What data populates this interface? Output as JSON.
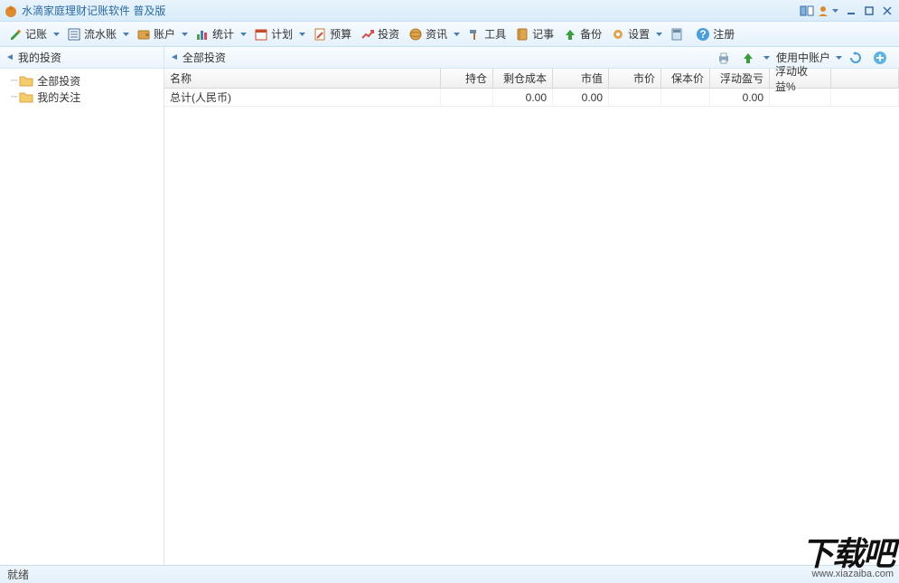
{
  "title": "水滴家庭理财记账软件 普及版",
  "toolbar": [
    {
      "label": "记账",
      "dd": true,
      "color": "#3a9d3a"
    },
    {
      "label": "流水账",
      "dd": true,
      "color": "#3a6aa6"
    },
    {
      "label": "账户",
      "dd": true,
      "color": "#c97a28"
    },
    {
      "label": "统计",
      "dd": true,
      "color": "#4a7db3"
    },
    {
      "label": "计划",
      "dd": true,
      "color": "#c94a28"
    },
    {
      "label": "预算",
      "dd": false,
      "color": "#c97a28"
    },
    {
      "label": "投资",
      "dd": false,
      "color": "#c94a28"
    },
    {
      "label": "资讯",
      "dd": true,
      "color": "#c97a28"
    },
    {
      "label": "工具",
      "dd": false,
      "color": "#6a8aa6"
    },
    {
      "label": "记事",
      "dd": false,
      "color": "#c97a28"
    },
    {
      "label": "备份",
      "dd": false,
      "color": "#3a9d3a"
    },
    {
      "label": "设置",
      "dd": true,
      "color": "#c97a28"
    },
    {
      "label": "注册",
      "dd": false,
      "color": "#3a7db3"
    }
  ],
  "sidebar": {
    "header": "我的投资",
    "items": [
      {
        "label": "全部投资"
      },
      {
        "label": "我的关注"
      }
    ]
  },
  "content": {
    "header": "全部投资",
    "account_label": "使用中账户",
    "columns": {
      "name": "名称",
      "hold": "持仓",
      "cost": "剩仓成本",
      "mval": "市值",
      "price": "市价",
      "base": "保本价",
      "pl": "浮动盈亏",
      "plr": "浮动收益%"
    },
    "rows": [
      {
        "name": "总计(人民币)",
        "hold": "",
        "cost": "0.00",
        "mval": "0.00",
        "price": "",
        "base": "",
        "pl": "0.00",
        "plr": ""
      }
    ]
  },
  "status": "就绪",
  "watermark": {
    "big": "下载吧",
    "small": "www.xiazaiba.com"
  }
}
